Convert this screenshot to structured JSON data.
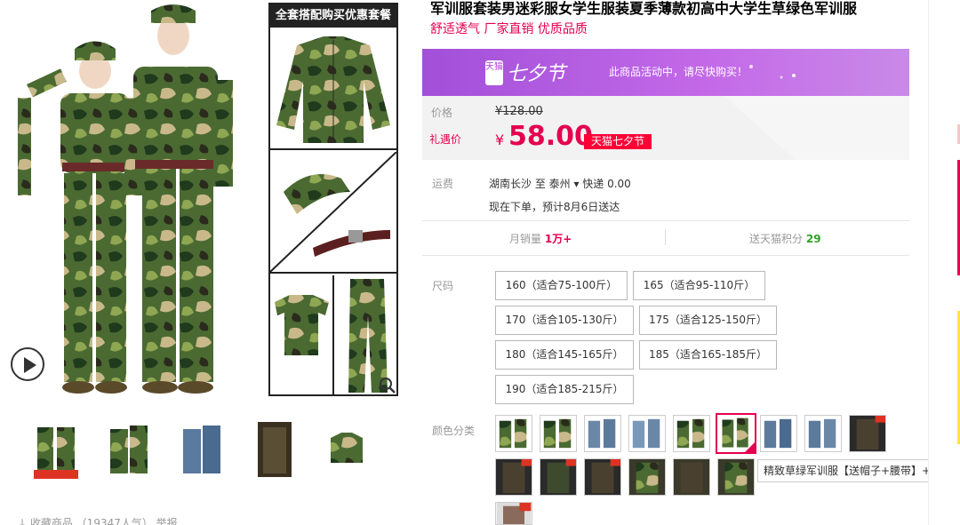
{
  "product": {
    "title": "军训服套装男迷彩服女学生服装夏季薄款初高中大学生草绿色军训服",
    "subtitle": "舒适透气 厂家直销 优质品质"
  },
  "gallery": {
    "combo_header": "全套搭配购买优惠套餐",
    "bottom_text": "↓ 收藏商品 （19347人气）                       举报"
  },
  "promo": {
    "logo_text": "天猫",
    "event_name": "七夕节",
    "message": "此商品活动中，请尽快购买！"
  },
  "price": {
    "original_label": "价格",
    "original_value": "¥128.00",
    "sale_label": "礼遇价",
    "currency": "¥",
    "sale_value": "58.00",
    "badge": "天猫七夕节"
  },
  "shipping": {
    "label": "运费",
    "line1": "湖南长沙  至  泰州 ▾  快递 0.00",
    "line2": "现在下单，预计8月6日送达"
  },
  "stats": {
    "sales_label": "月销量",
    "sales_value": "1万+",
    "points_label": "送天猫积分",
    "points_value": "29"
  },
  "sizes": {
    "label": "尺码",
    "options": [
      "160（适合75-100斤）",
      "165（适合95-110斤）",
      "170（适合105-130斤）",
      "175（适合125-150斤）",
      "180（适合145-165斤）",
      "185（适合165-185斤）",
      "190（适合185-215斤）"
    ]
  },
  "colors": {
    "label": "颜色分类",
    "tooltip": "精致草绿军训服【送帽子+腰带】+T恤"
  },
  "palette": {
    "accent": "#e5004f",
    "tmall_red": "#ff0036",
    "camo_green": "#3d5b2f",
    "promo_purple": "#b45be3"
  }
}
